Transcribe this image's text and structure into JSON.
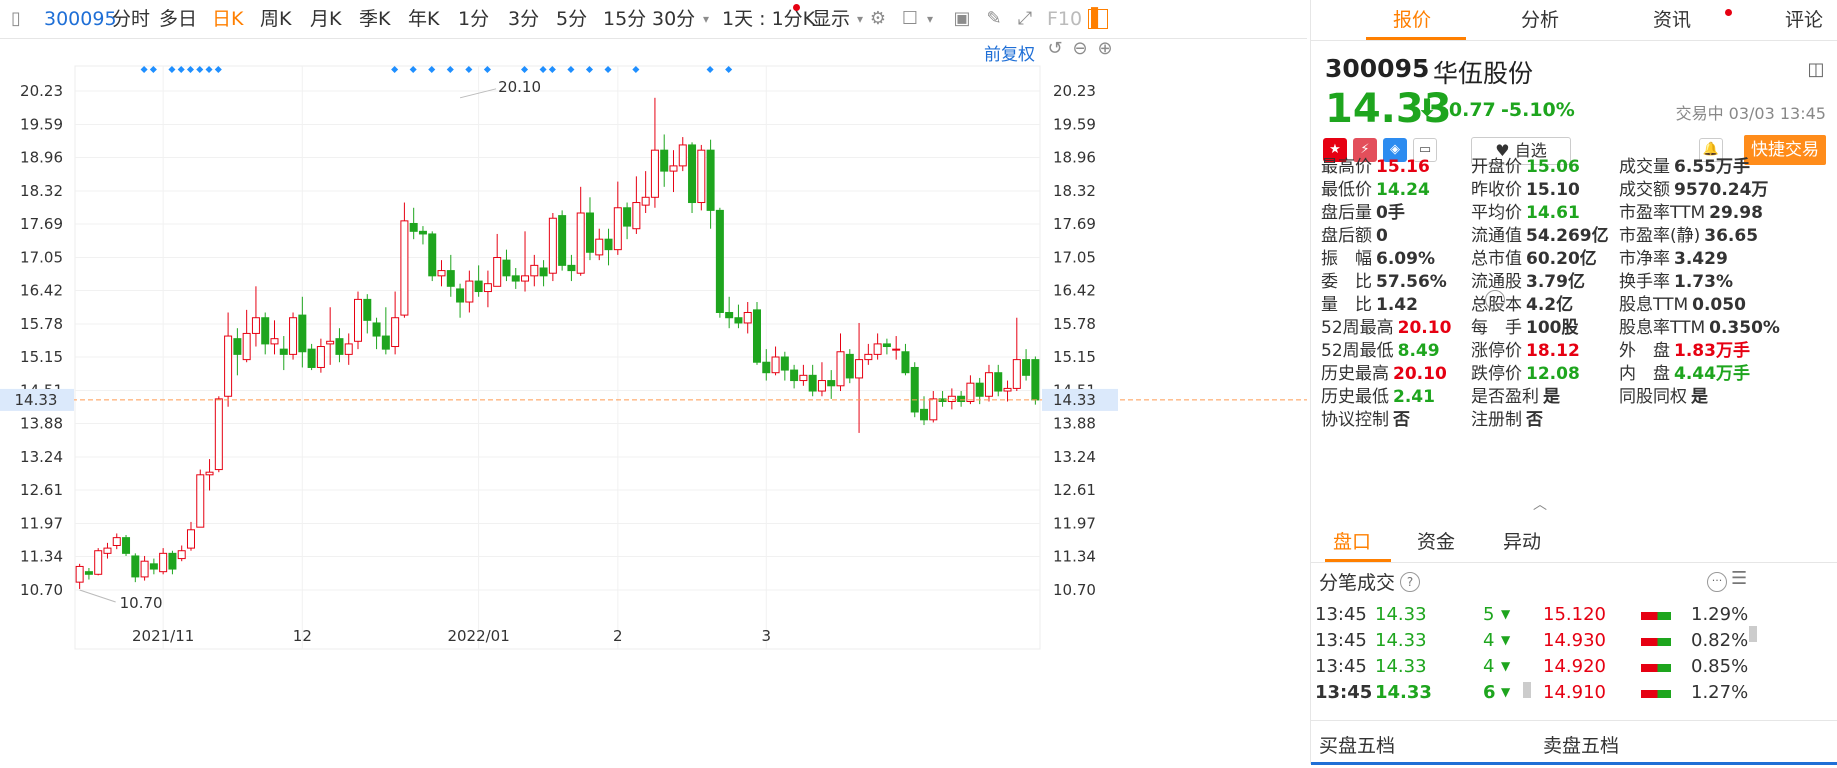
{
  "toolbar": {
    "code": "300095",
    "items": [
      "分时",
      "多日",
      "日K",
      "周K",
      "月K",
      "季K",
      "年K",
      "1分",
      "3分",
      "5分",
      "15分",
      "30分"
    ],
    "active_index": 2,
    "interval": "1天 : 1分K",
    "display": "显示",
    "f10": "F10",
    "restore": "前复权"
  },
  "chart_data": {
    "type": "candlestick",
    "y_ticks": [
      "20.23",
      "19.59",
      "18.96",
      "18.32",
      "17.69",
      "17.05",
      "16.42",
      "15.78",
      "15.15",
      "14.51",
      "13.88",
      "13.24",
      "12.61",
      "11.97",
      "11.34",
      "10.70"
    ],
    "ylim": [
      10.7,
      20.23
    ],
    "x_ticks": [
      {
        "label": "2021/11",
        "index": 9
      },
      {
        "label": "12",
        "index": 24
      },
      {
        "label": "2022/01",
        "index": 43
      },
      {
        "label": "2",
        "index": 58
      },
      {
        "label": "3",
        "index": 74
      }
    ],
    "current_price": "14.33",
    "max_label": "20.10",
    "max_index": 41,
    "min_label": "10.70",
    "min_index": 0,
    "colors": {
      "up": "#e60012",
      "down": "#1ea51e",
      "current": "#ff9a52",
      "marker": "#1f8fff"
    },
    "marker_indices": [
      7,
      8,
      10,
      11,
      12,
      13,
      14,
      15,
      34,
      36,
      38,
      40,
      42,
      44,
      48,
      50,
      51,
      53,
      55,
      57,
      60,
      68,
      70
    ],
    "candles": [
      [
        10.85,
        11.15,
        11.2,
        10.72
      ],
      [
        11.05,
        11.0,
        11.12,
        10.9
      ],
      [
        11.0,
        11.45,
        11.5,
        10.98
      ],
      [
        11.4,
        11.5,
        11.6,
        11.3
      ],
      [
        11.55,
        11.7,
        11.78,
        11.48
      ],
      [
        11.7,
        11.4,
        11.75,
        11.35
      ],
      [
        11.35,
        10.95,
        11.4,
        10.85
      ],
      [
        10.95,
        11.25,
        11.35,
        10.88
      ],
      [
        11.2,
        11.1,
        11.3,
        11.0
      ],
      [
        11.05,
        11.4,
        11.5,
        11.0
      ],
      [
        11.4,
        11.1,
        11.45,
        11.0
      ],
      [
        11.3,
        11.45,
        11.55,
        11.25
      ],
      [
        11.5,
        11.85,
        12.0,
        11.45
      ],
      [
        11.9,
        12.9,
        13.0,
        11.9
      ],
      [
        12.9,
        12.95,
        13.2,
        12.6
      ],
      [
        13.0,
        14.35,
        14.4,
        12.95
      ],
      [
        14.4,
        15.55,
        16.0,
        14.2
      ],
      [
        15.5,
        15.2,
        15.7,
        14.8
      ],
      [
        15.1,
        15.6,
        16.05,
        15.05
      ],
      [
        15.6,
        15.9,
        16.5,
        15.35
      ],
      [
        15.9,
        15.4,
        16.0,
        15.2
      ],
      [
        15.4,
        15.5,
        15.85,
        15.2
      ],
      [
        15.3,
        15.2,
        15.55,
        14.9
      ],
      [
        15.2,
        15.9,
        16.0,
        15.1
      ],
      [
        15.95,
        15.25,
        16.3,
        14.95
      ],
      [
        15.3,
        14.95,
        15.4,
        14.9
      ],
      [
        14.95,
        15.35,
        15.5,
        14.85
      ],
      [
        15.4,
        15.45,
        16.1,
        15.0
      ],
      [
        15.5,
        15.2,
        15.7,
        15.05
      ],
      [
        15.2,
        15.4,
        15.6,
        15.0
      ],
      [
        15.45,
        16.25,
        16.4,
        15.3
      ],
      [
        16.25,
        15.85,
        16.35,
        15.6
      ],
      [
        15.8,
        15.55,
        15.9,
        15.3
      ],
      [
        15.55,
        15.3,
        16.1,
        15.2
      ],
      [
        15.35,
        15.9,
        16.4,
        15.2
      ],
      [
        15.95,
        17.75,
        18.1,
        15.9
      ],
      [
        17.7,
        17.55,
        18.0,
        17.4
      ],
      [
        17.55,
        17.5,
        17.65,
        17.3
      ],
      [
        17.5,
        16.7,
        17.55,
        16.6
      ],
      [
        16.7,
        16.8,
        17.0,
        16.5
      ],
      [
        16.8,
        16.5,
        17.1,
        16.3
      ],
      [
        16.45,
        16.2,
        16.55,
        15.9
      ],
      [
        16.2,
        16.6,
        16.8,
        16.0
      ],
      [
        16.6,
        16.4,
        16.9,
        16.3
      ],
      [
        16.4,
        16.55,
        16.8,
        16.1
      ],
      [
        16.5,
        17.05,
        17.5,
        16.8
      ],
      [
        17.0,
        16.7,
        17.2,
        16.6
      ],
      [
        16.7,
        16.6,
        16.85,
        16.45
      ],
      [
        16.6,
        16.7,
        17.55,
        16.4
      ],
      [
        16.7,
        16.9,
        17.1,
        16.5
      ],
      [
        16.85,
        16.7,
        17.0,
        16.5
      ],
      [
        16.75,
        17.8,
        17.9,
        16.6
      ],
      [
        17.85,
        16.9,
        17.95,
        16.8
      ],
      [
        16.9,
        16.8,
        17.1,
        16.6
      ],
      [
        16.75,
        17.9,
        18.4,
        16.7
      ],
      [
        17.9,
        17.15,
        18.2,
        17.0
      ],
      [
        17.1,
        17.4,
        17.6,
        17.0
      ],
      [
        17.4,
        17.2,
        17.6,
        16.9
      ],
      [
        17.2,
        18.0,
        18.5,
        17.1
      ],
      [
        18.0,
        17.65,
        18.1,
        17.4
      ],
      [
        17.6,
        18.1,
        18.6,
        17.5
      ],
      [
        18.05,
        18.2,
        18.7,
        17.9
      ],
      [
        18.2,
        19.1,
        20.1,
        18.0
      ],
      [
        19.1,
        18.7,
        19.4,
        18.4
      ],
      [
        18.7,
        18.8,
        19.1,
        18.3
      ],
      [
        18.8,
        19.2,
        19.35,
        18.7
      ],
      [
        19.2,
        18.1,
        19.25,
        17.9
      ],
      [
        18.1,
        19.1,
        19.2,
        17.95
      ],
      [
        19.1,
        17.95,
        19.3,
        17.6
      ],
      [
        17.95,
        16.0,
        18.0,
        15.9
      ],
      [
        16.0,
        15.9,
        16.3,
        15.7
      ],
      [
        15.9,
        15.8,
        16.15,
        15.7
      ],
      [
        15.8,
        16.0,
        16.2,
        15.6
      ],
      [
        16.05,
        15.05,
        16.2,
        15.0
      ],
      [
        15.05,
        14.85,
        15.3,
        14.7
      ],
      [
        14.85,
        15.15,
        15.35,
        14.8
      ],
      [
        15.15,
        14.9,
        15.25,
        14.7
      ],
      [
        14.9,
        14.7,
        15.0,
        14.55
      ],
      [
        14.7,
        14.8,
        15.0,
        14.6
      ],
      [
        14.8,
        14.5,
        15.0,
        14.4
      ],
      [
        14.5,
        14.7,
        15.05,
        14.4
      ],
      [
        14.7,
        14.6,
        14.9,
        14.35
      ],
      [
        14.6,
        15.25,
        15.6,
        14.5
      ],
      [
        15.2,
        14.75,
        15.3,
        14.65
      ],
      [
        14.75,
        15.1,
        15.8,
        13.7
      ],
      [
        15.1,
        15.2,
        15.4,
        15.0
      ],
      [
        15.2,
        15.4,
        15.6,
        15.1
      ],
      [
        15.4,
        15.35,
        15.5,
        15.2
      ],
      [
        15.3,
        15.3,
        15.55,
        15.1
      ],
      [
        15.25,
        14.85,
        15.4,
        14.8
      ],
      [
        14.95,
        14.1,
        15.05,
        14.0
      ],
      [
        14.15,
        13.95,
        14.4,
        13.85
      ],
      [
        13.95,
        14.35,
        14.5,
        13.9
      ],
      [
        14.35,
        14.3,
        14.5,
        14.2
      ],
      [
        14.3,
        14.4,
        14.55,
        14.15
      ],
      [
        14.4,
        14.3,
        14.5,
        14.2
      ],
      [
        14.3,
        14.65,
        14.8,
        14.25
      ],
      [
        14.65,
        14.4,
        14.75,
        14.25
      ],
      [
        14.4,
        14.85,
        15.0,
        14.3
      ],
      [
        14.85,
        14.5,
        15.0,
        14.4
      ],
      [
        14.5,
        14.55,
        14.7,
        14.3
      ],
      [
        14.55,
        15.1,
        15.9,
        14.5
      ],
      [
        15.1,
        14.8,
        15.3,
        14.7
      ],
      [
        15.1,
        14.33,
        15.16,
        14.24
      ]
    ]
  },
  "right": {
    "tabs": [
      "报价",
      "分析",
      "资讯",
      "评论"
    ],
    "active_tab": 0,
    "code": "300095",
    "name": "华伍股份",
    "price": "14.33",
    "change": "-0.77",
    "change_pct": "-5.10%",
    "time": "交易中 03/03 13:45",
    "fav": "自选",
    "trade": "快捷交易",
    "quotes": [
      [
        [
          "最高价",
          "15.16",
          "red"
        ],
        [
          "开盘价",
          "15.06",
          "green"
        ],
        [
          "成交量",
          "6.55万手",
          "black"
        ]
      ],
      [
        [
          "最低价",
          "14.24",
          "green"
        ],
        [
          "昨收价",
          "15.10",
          "black"
        ],
        [
          "成交额",
          "9570.24万",
          "black"
        ]
      ],
      [
        [
          "盘后量",
          "0手",
          "black"
        ],
        [
          "平均价",
          "14.61",
          "green"
        ],
        [
          "市盈率TTM",
          "29.98",
          "black"
        ]
      ],
      [
        [
          "盘后额",
          "0",
          "black"
        ],
        [
          "流通值",
          "54.269亿",
          "black"
        ],
        [
          "市盈率(静)",
          "36.65",
          "black"
        ]
      ],
      [
        [
          "振　幅",
          "6.09%",
          "black"
        ],
        [
          "总市值",
          "60.20亿",
          "black"
        ],
        [
          "市净率",
          "3.429",
          "black"
        ]
      ],
      [
        [
          "委　比",
          "57.56%",
          "black"
        ],
        [
          "流通股",
          "3.79亿",
          "black"
        ],
        [
          "换手率",
          "1.73%",
          "black"
        ]
      ],
      [
        [
          "量　比",
          "1.42",
          "black"
        ],
        [
          "总股本",
          "4.2亿",
          "black"
        ],
        [
          "股息TTM",
          "0.050",
          "black"
        ]
      ],
      [
        [
          "52周最高",
          "20.10",
          "red"
        ],
        [
          "每　手",
          "100股",
          "black"
        ],
        [
          "股息率TTM",
          "0.350%",
          "black"
        ]
      ],
      [
        [
          "52周最低",
          "8.49",
          "green"
        ],
        [
          "涨停价",
          "18.12",
          "red"
        ],
        [
          "外　盘",
          "1.83万手",
          "red"
        ]
      ],
      [
        [
          "历史最高",
          "20.10",
          "red"
        ],
        [
          "跌停价",
          "12.08",
          "green"
        ],
        [
          "内　盘",
          "4.44万手",
          "green"
        ]
      ],
      [
        [
          "历史最低",
          "2.41",
          "green"
        ],
        [
          "是否盈利",
          "是",
          "black"
        ],
        [
          "同股同权",
          "是",
          "black"
        ]
      ],
      [
        [
          "协议控制",
          "否",
          "black"
        ],
        [
          "注册制",
          "否",
          "black"
        ],
        [
          "",
          "",
          " black"
        ]
      ]
    ],
    "subtabs": [
      "盘口",
      "资金",
      "异动"
    ],
    "fb_title": "分笔成交",
    "trades": [
      [
        "13:45",
        "14.33",
        "5"
      ],
      [
        "13:45",
        "14.33",
        "4"
      ],
      [
        "13:45",
        "14.33",
        "4"
      ],
      [
        "13:45",
        "14.33",
        "6"
      ]
    ],
    "depth": [
      [
        "15.120",
        "1.29%"
      ],
      [
        "14.930",
        "0.82%"
      ],
      [
        "14.920",
        "0.85%"
      ],
      [
        "14.910",
        "1.27%"
      ]
    ],
    "buy5": "买盘五档",
    "sell5": "卖盘五档"
  }
}
